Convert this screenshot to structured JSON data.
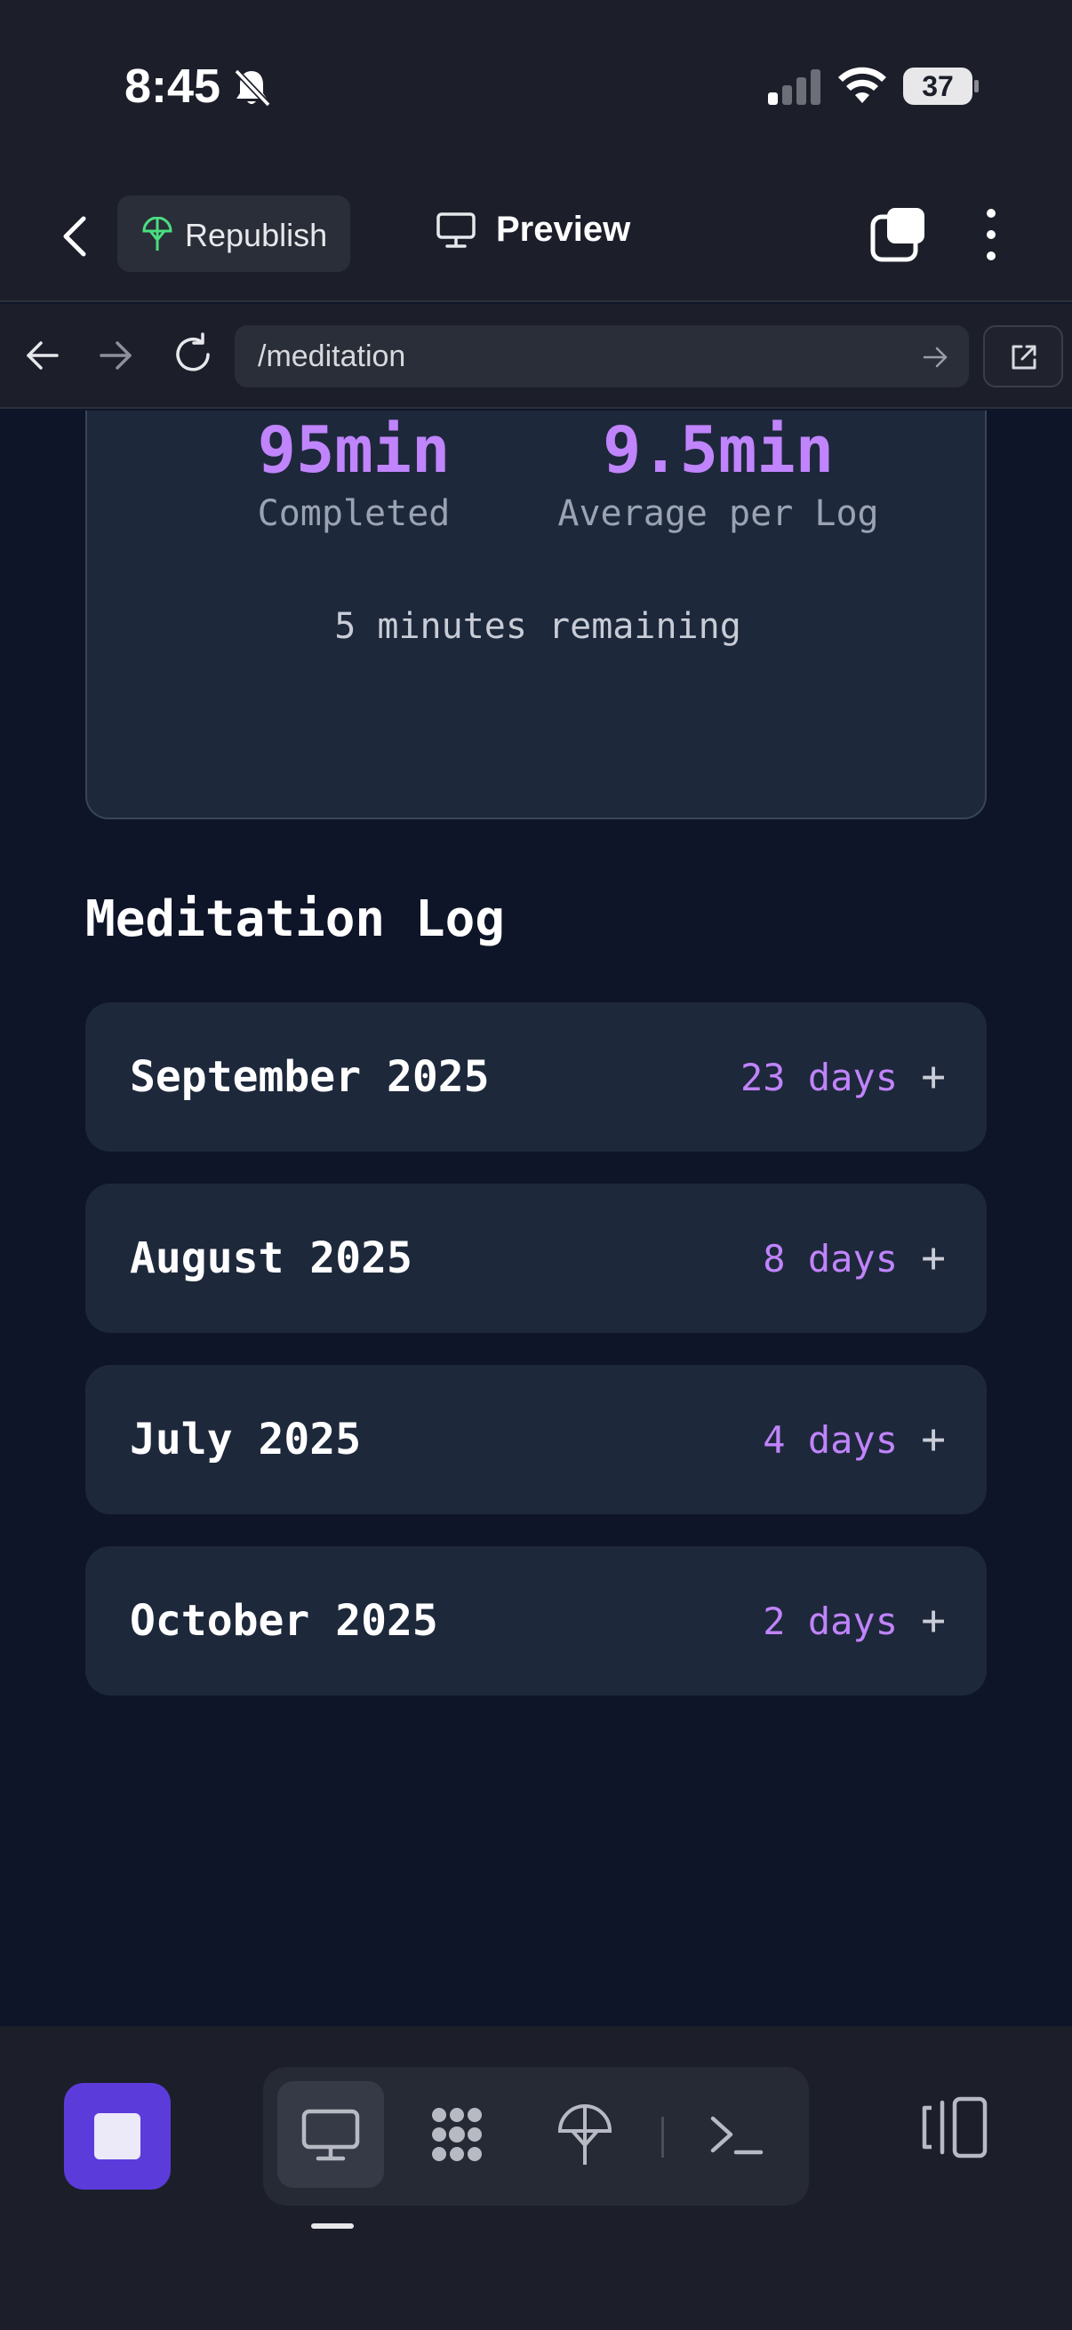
{
  "status_bar": {
    "time": "8:45",
    "battery": "37"
  },
  "app_bar": {
    "republish_label": "Republish",
    "preview_label": "Preview"
  },
  "url_bar": {
    "url": "/meditation"
  },
  "stats": {
    "completed_value": "95min",
    "completed_label": "Completed",
    "average_value": "9.5min",
    "average_label": "Average per Log",
    "remaining_text": "5 minutes remaining"
  },
  "meditation_log": {
    "title": "Meditation Log",
    "items": [
      {
        "month": "September 2025",
        "days": "23 days"
      },
      {
        "month": "August 2025",
        "days": "8 days"
      },
      {
        "month": "July 2025",
        "days": "4 days"
      },
      {
        "month": "October 2025",
        "days": "2 days"
      }
    ],
    "expand_symbol": "+"
  },
  "colors": {
    "accent": "#c084fc",
    "card": "#1e283b",
    "page_bg": "#0f1528",
    "chrome_bg": "#1c1f2a",
    "stop_button": "#5b3cdb"
  },
  "icons": [
    "bell-slash-icon",
    "signal-icon",
    "wifi-icon",
    "back-chevron-icon",
    "antenna-icon",
    "monitor-icon",
    "tabs-icon",
    "more-vertical-icon",
    "arrow-left-icon",
    "arrow-right-icon",
    "reload-icon",
    "open-external-icon",
    "stop-icon",
    "apps-icon",
    "publish-icon",
    "terminal-icon",
    "split-view-icon"
  ]
}
